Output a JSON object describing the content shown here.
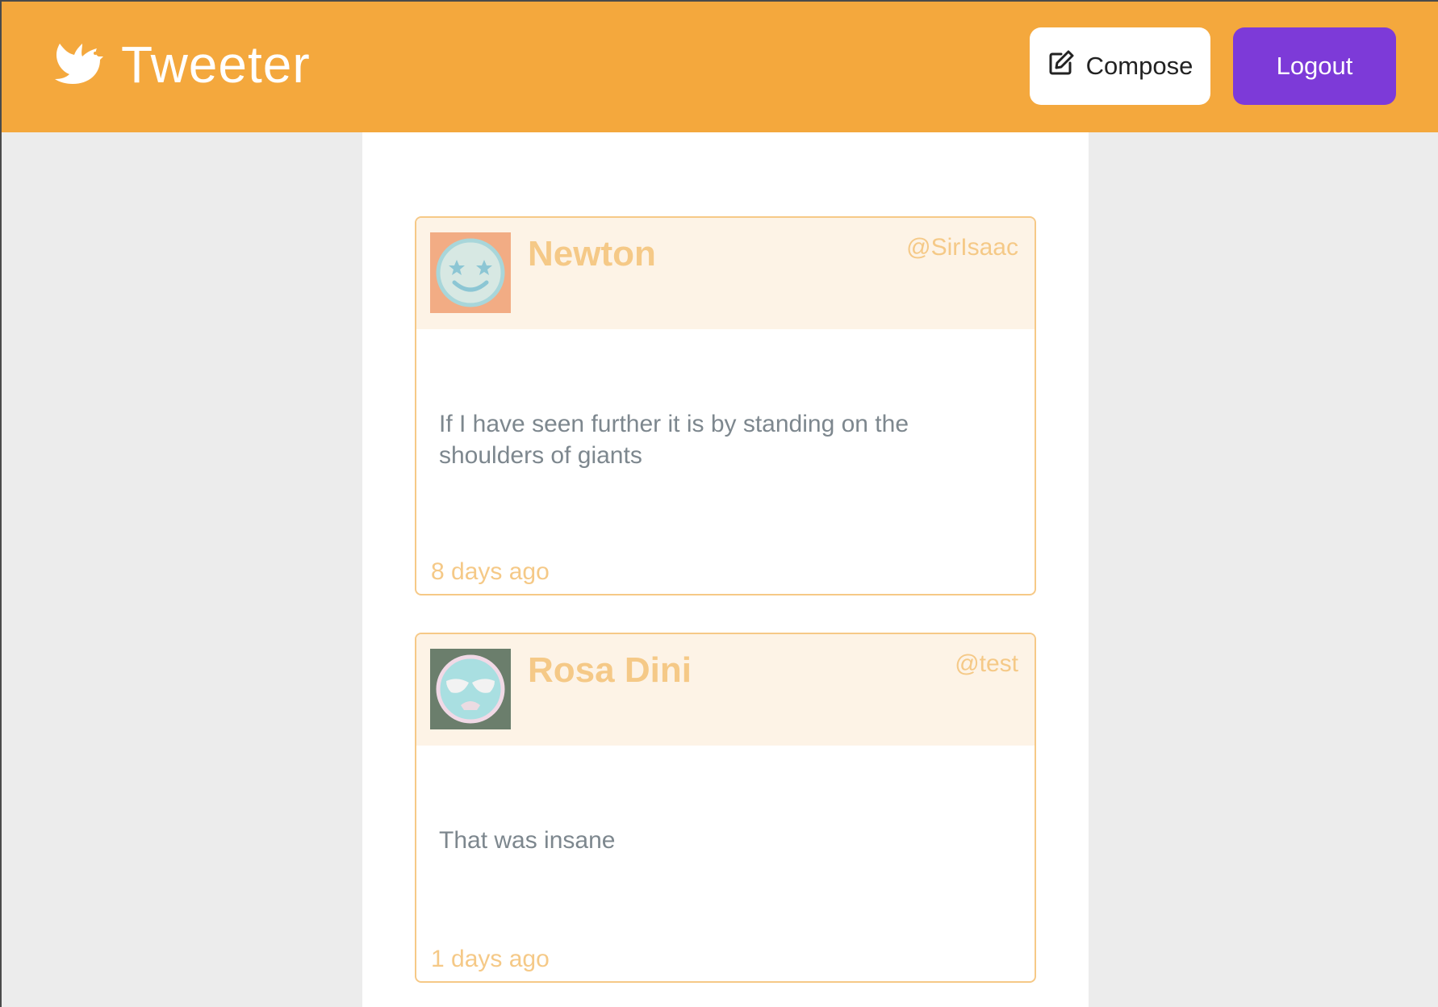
{
  "header": {
    "brand_name": "Tweeter",
    "brand_icon": "dove-icon",
    "compose_label": "Compose",
    "compose_icon": "edit-icon",
    "logout_label": "Logout"
  },
  "colors": {
    "header_bg": "#f4a83d",
    "logout_bg": "#7d3ad8",
    "accent_text": "#f5c987",
    "tweet_border": "#f6c987",
    "tweet_header_bg": "#fdf3e6",
    "page_bg": "#ececec"
  },
  "tweets": [
    {
      "name": "Newton",
      "handle": "@SirIsaac",
      "avatar": "star-eyes-avatar-icon",
      "text": "If I have seen further it is by standing on the shoulders of giants",
      "time": "8 days ago"
    },
    {
      "name": "Rosa Dini",
      "handle": "@test",
      "avatar": "sunglasses-avatar-icon",
      "text": "That was insane",
      "time": "1 days ago"
    }
  ]
}
